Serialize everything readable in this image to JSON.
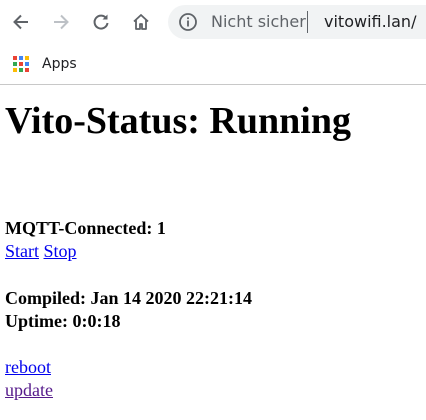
{
  "browser": {
    "security_label": "Nicht sicher",
    "url": "vitowifi.lan/"
  },
  "bookmarks": {
    "apps_label": "Apps"
  },
  "page": {
    "title": "Vito-Status: Running",
    "mqtt_label": "MQTT-Connected: 1",
    "start_link": "Start",
    "stop_link": "Stop",
    "compiled_label": "Compiled: Jan 14 2020 22:21:14",
    "uptime_label": "Uptime: 0:0:18",
    "reboot_link": "reboot",
    "update_link": "update"
  }
}
